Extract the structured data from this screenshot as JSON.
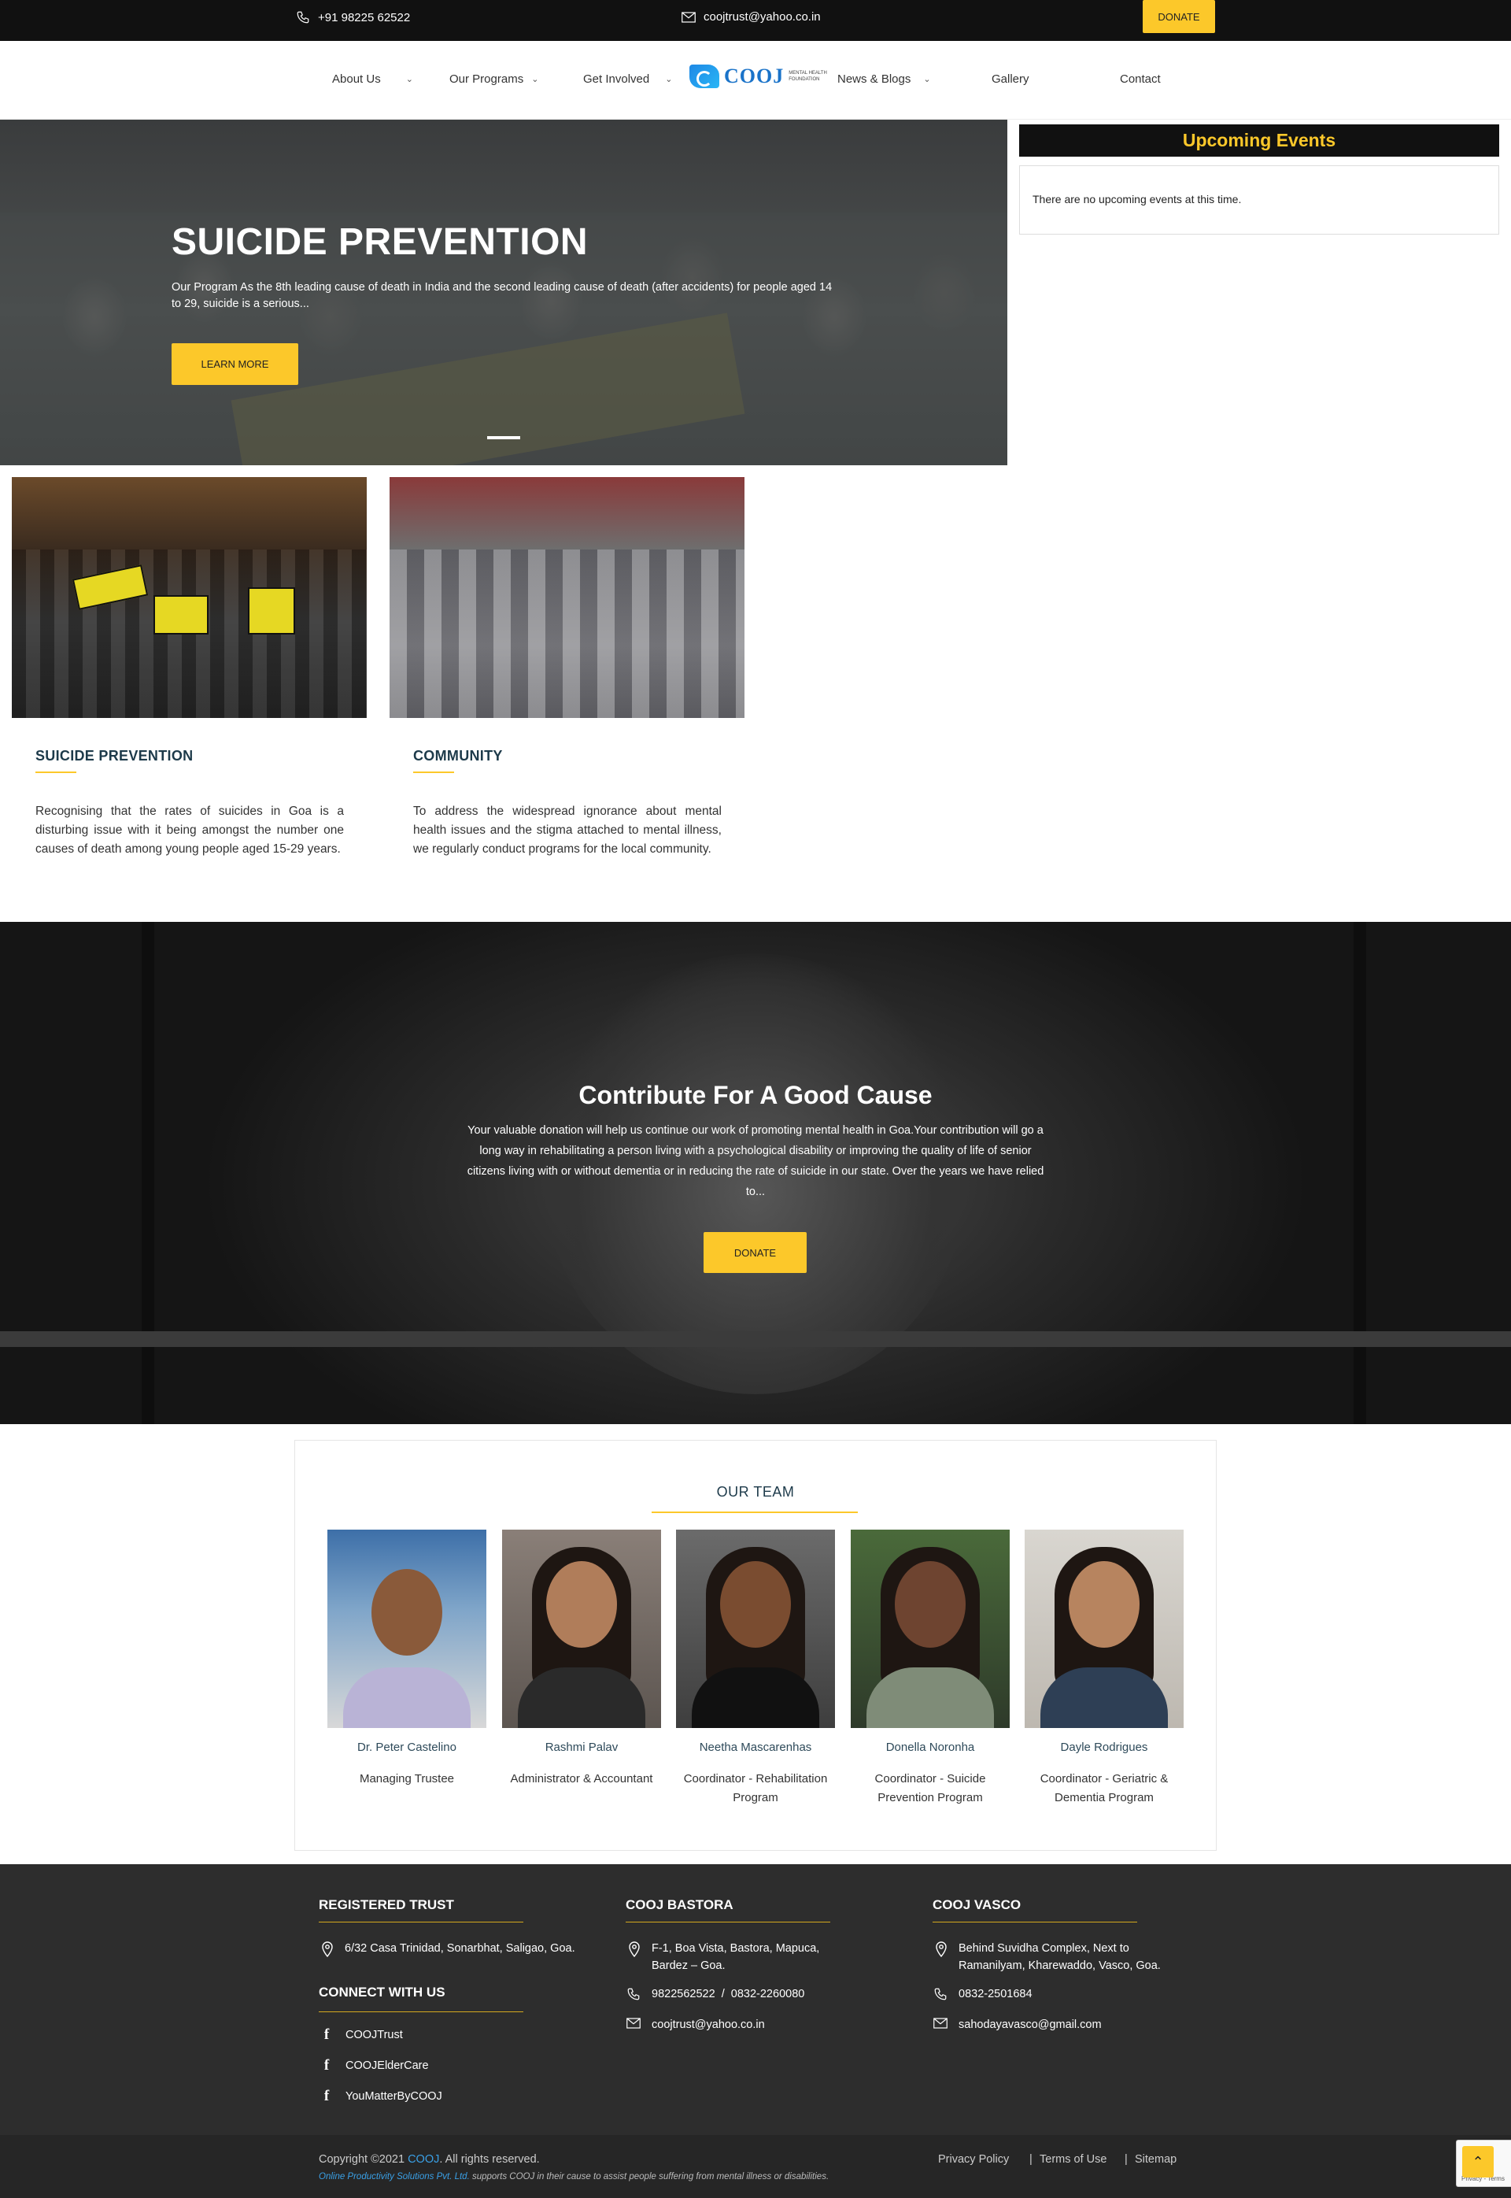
{
  "topbar": {
    "phone": "+91 98225 62522",
    "email": "coojtrust@yahoo.co.in",
    "donate_label": "DONATE"
  },
  "nav": {
    "items": [
      {
        "label": "About Us",
        "has_dropdown": true
      },
      {
        "label": "Our Programs",
        "has_dropdown": true
      },
      {
        "label": "Get Involved",
        "has_dropdown": true
      },
      {
        "label": "News & Blogs",
        "has_dropdown": true
      },
      {
        "label": "Gallery",
        "has_dropdown": false
      },
      {
        "label": "Contact",
        "has_dropdown": false
      }
    ],
    "logo": {
      "word": "COOJ",
      "tagline": "Mental Health Foundation"
    }
  },
  "hero": {
    "title": "SUICIDE PREVENTION",
    "description": "Our Program As the 8th leading cause of death in India and the second leading cause of death (after accidents) for people aged 14 to 29, suicide is a serious...",
    "button_label": "LEARN MORE"
  },
  "events": {
    "title": "Upcoming Events",
    "empty_message": "There are no upcoming events at this time."
  },
  "programs": [
    {
      "title": "SUICIDE PREVENTION",
      "text": "Recognising that the rates of suicides in Goa is a disturbing issue with it being amongst the number one causes of death among young people aged 15-29 years."
    },
    {
      "title": "COMMUNITY",
      "text": "To address the widespread ignorance about mental health issues and the stigma attached to mental illness, we regularly conduct programs for the local community."
    }
  ],
  "contribute": {
    "title": "Contribute For A Good Cause",
    "text": "Your valuable donation will help us continue our work of promoting mental health in Goa.Your contribution will go a long way in rehabilitating a person living with a psychological disability or improving the quality of life of senior citizens living with or without dementia or in reducing the rate of suicide in our state. Over the years we have relied to...",
    "button_label": "DONATE"
  },
  "team": {
    "title": "OUR TEAM",
    "members": [
      {
        "name": "Dr. Peter Castelino",
        "role": "Managing Trustee"
      },
      {
        "name": "Rashmi Palav",
        "role": "Administrator & Accountant"
      },
      {
        "name": "Neetha Mascarenhas",
        "role": "Coordinator - Rehabilitation Program"
      },
      {
        "name": "Donella Noronha",
        "role": "Coordinator - Suicide Prevention Program"
      },
      {
        "name": "Dayle Rodrigues",
        "role": "Coordinator - Geriatric & Dementia Program"
      }
    ]
  },
  "footer": {
    "registered": {
      "title": "REGISTERED TRUST",
      "address": "6/32 Casa Trinidad, Sonarbhat, Saligao, Goa."
    },
    "connect": {
      "title": "CONNECT WITH US",
      "links": [
        "COOJTrust",
        "COOJElderCare",
        "YouMatterByCOOJ"
      ]
    },
    "bastora": {
      "title": "COOJ BASTORA",
      "address": "F-1, Boa Vista, Bastora, Mapuca, Bardez – Goa.",
      "phone": "9822562522  /  0832-2260080",
      "email": "coojtrust@yahoo.co.in"
    },
    "vasco": {
      "title": "COOJ VASCO",
      "address": "Behind Suvidha Complex, Next to Ramanilyam, Kharewaddo, Vasco, Goa.",
      "phone": "0832-2501684",
      "email": "sahodayavasco@gmail.com"
    }
  },
  "bottom": {
    "copyright_prefix": "Copyright ©2021 ",
    "copyright_brand": "COOJ",
    "copyright_suffix": ". All rights reserved.",
    "ops_brand": "Online Productivity Solutions Pvt. Ltd.",
    "ops_text": " supports COOJ in their cause to assist people suffering from mental illness or disabilities.",
    "links": [
      "Privacy Policy",
      "Terms of Use",
      "Sitemap"
    ],
    "recaptcha_text": "Privacy - Terms"
  },
  "colors": {
    "accent": "#fcc82a",
    "dark": "#111111",
    "footer": "#2d2d2d",
    "brand_blue": "#1a73c9"
  }
}
